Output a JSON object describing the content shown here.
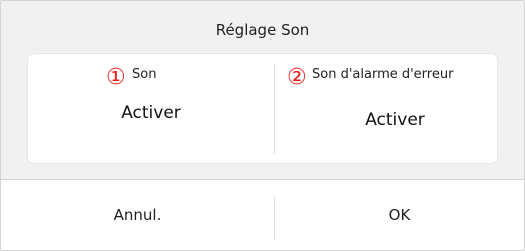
{
  "dialog": {
    "title": "Réglage Son"
  },
  "settings": [
    {
      "marker": "①",
      "label": "Son",
      "value": "Activer"
    },
    {
      "marker": "②",
      "label": "Son d'alarme d'erreur",
      "value": "Activer"
    }
  ],
  "buttons": {
    "cancel_label": "Annul.",
    "ok_label": "OK"
  },
  "colors": {
    "marker": "#e8201c",
    "header_bg": "#f1f1f1",
    "card_bg": "#ffffff"
  }
}
